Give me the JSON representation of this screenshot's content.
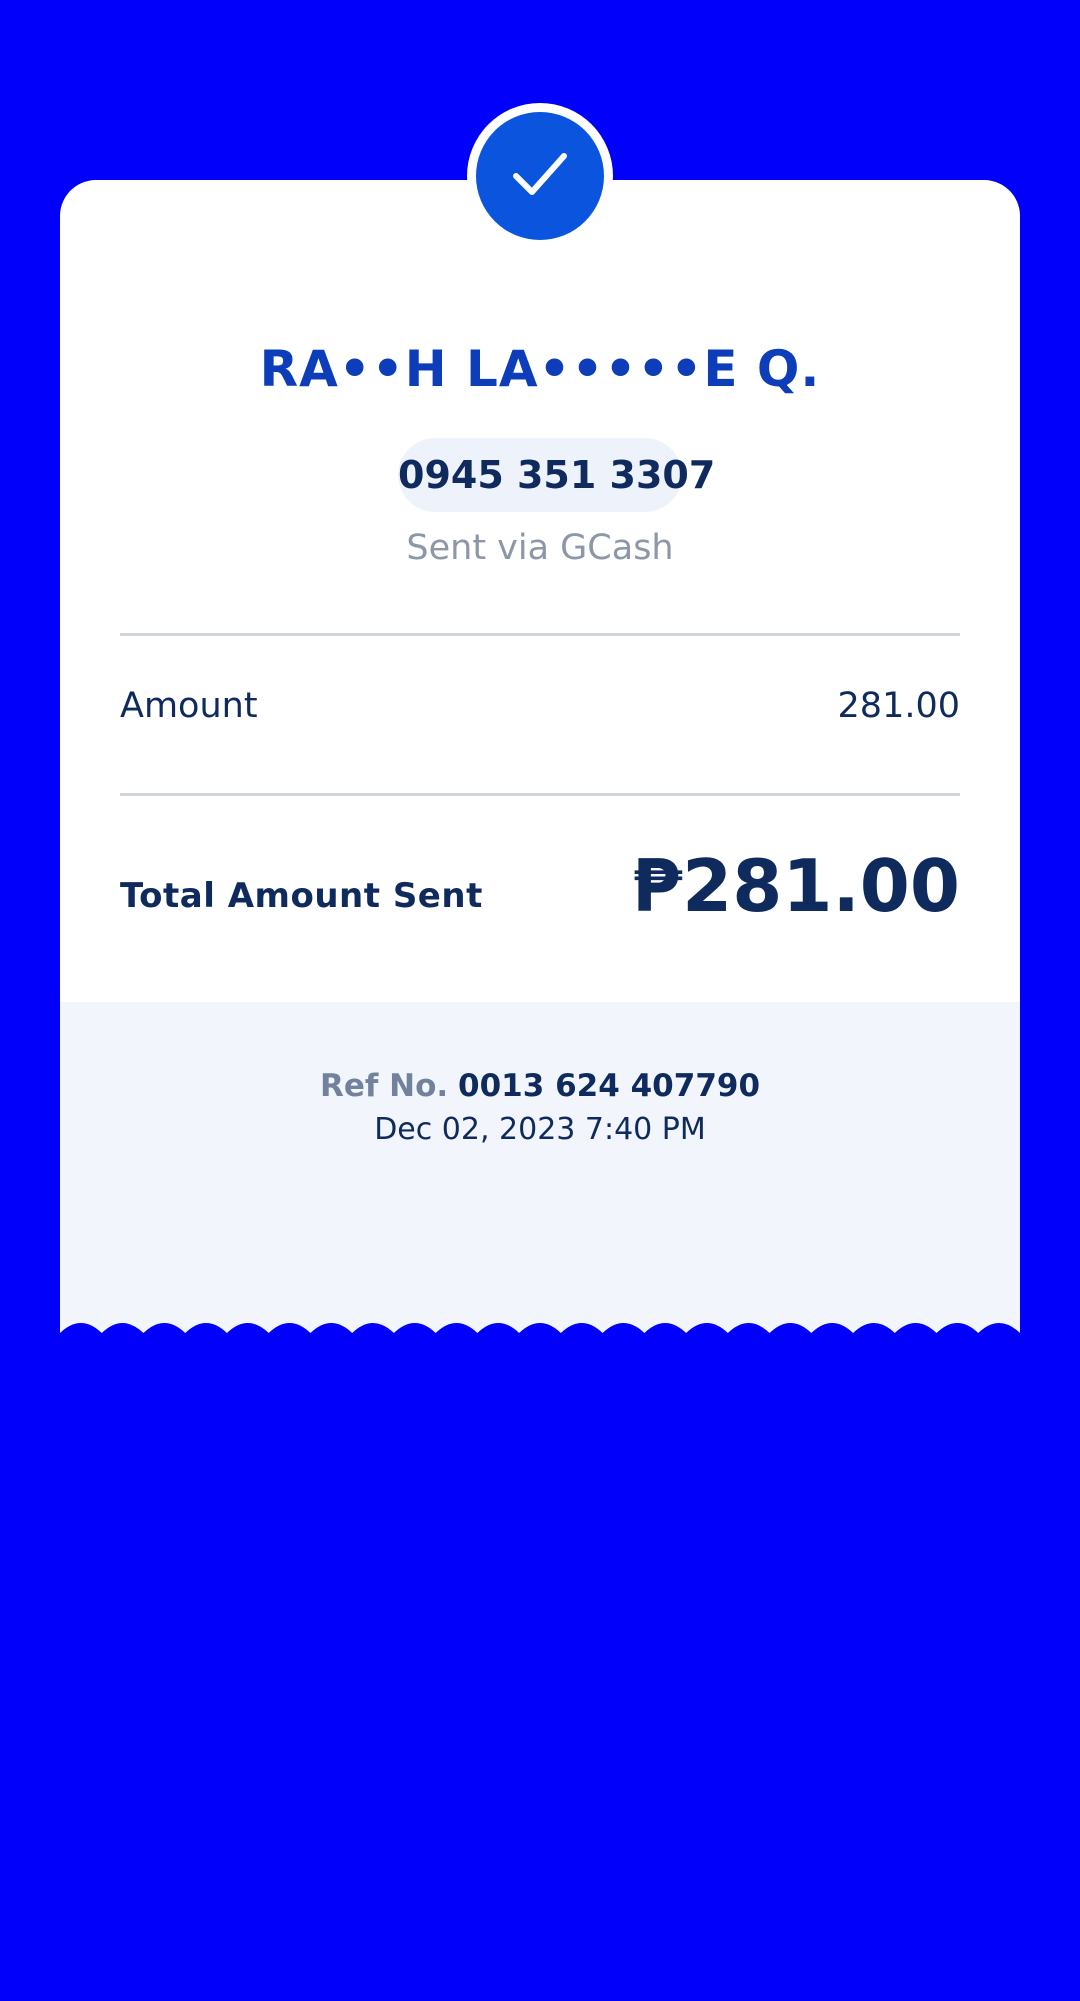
{
  "receipt": {
    "recipient_name": "RA••H LA•••••E Q.",
    "phone_number": "0945 351 3307",
    "sent_via": "Sent via GCash",
    "amount_label": "Amount",
    "amount_value": "281.00",
    "total_label": "Total Amount Sent",
    "total_value": "₱281.00",
    "ref_label": "Ref No.",
    "ref_number": "0013 624 407790",
    "datetime": "Dec 02, 2023 7:40 PM"
  },
  "icons": {
    "status": "check-icon"
  },
  "colors": {
    "background": "#0000fb",
    "accent": "#0b55de",
    "name": "#0d3db8",
    "text": "#0f2a5c",
    "muted": "#8c97a7",
    "footer": "#f2f6fc"
  }
}
